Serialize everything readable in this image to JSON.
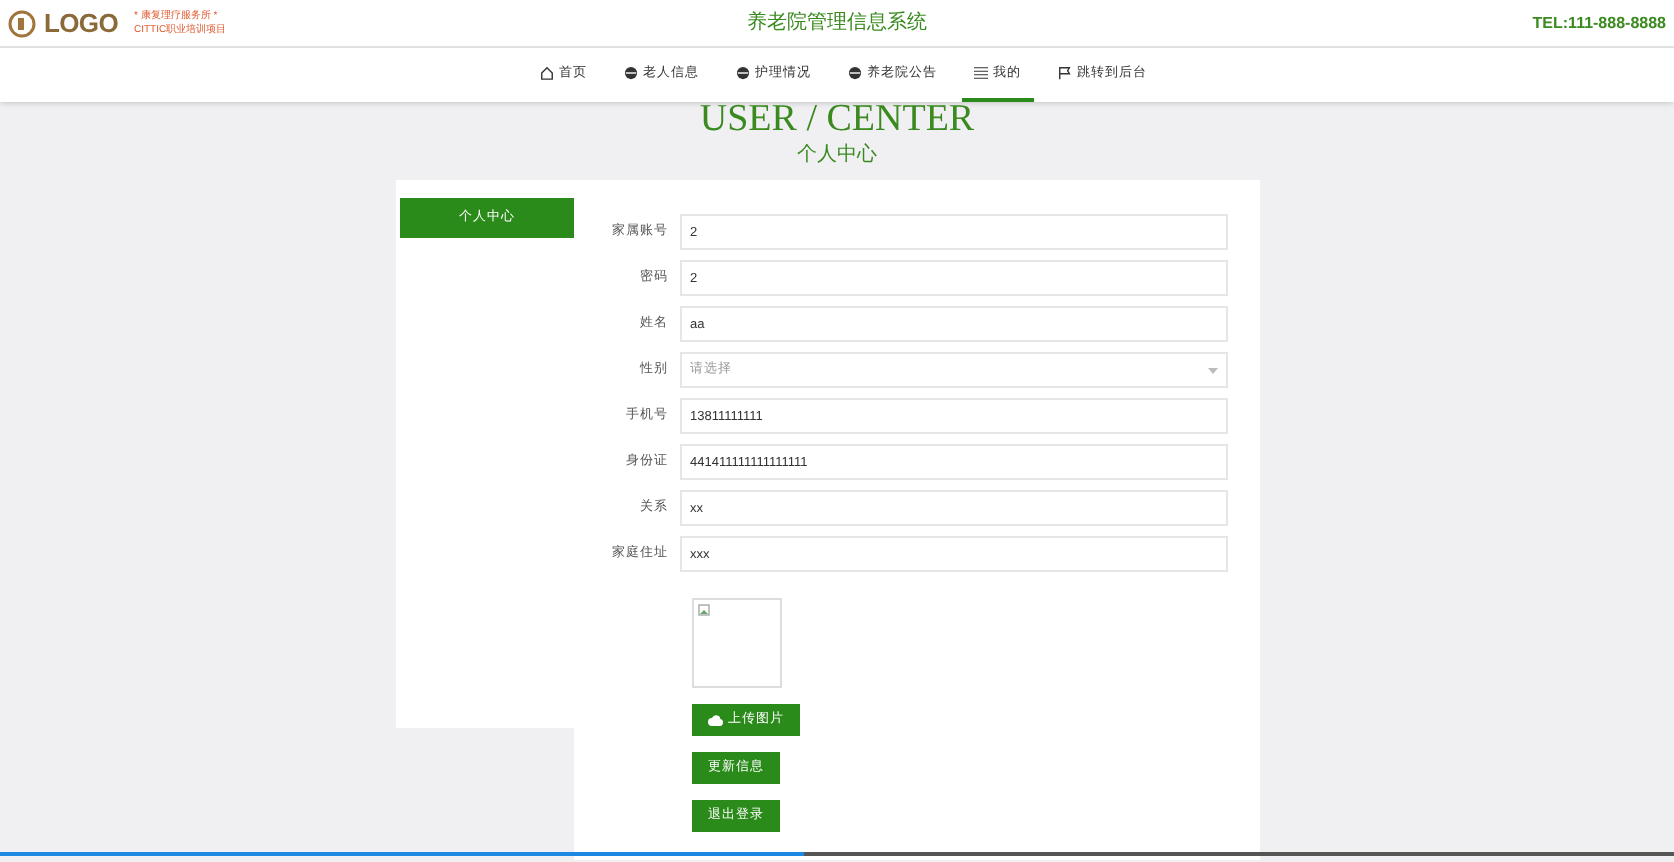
{
  "header": {
    "logo": "LOGO",
    "slogan_line_1": "* 康复理疗服务所 *",
    "slogan_line_2": "CITTIC职业培训项目",
    "title": "养老院管理信息系统",
    "phone": "TEL:111-888-8888"
  },
  "nav": [
    {
      "label": "首页",
      "kind": "home",
      "selected": false
    },
    {
      "label": "老人信息",
      "kind": "disc",
      "selected": false
    },
    {
      "label": "护理情况",
      "kind": "disc",
      "selected": false
    },
    {
      "label": "养老院公告",
      "kind": "disc",
      "selected": false
    },
    {
      "label": "我的",
      "kind": "list",
      "selected": true
    },
    {
      "label": "跳转到后台",
      "kind": "flag",
      "selected": false
    }
  ],
  "heading": {
    "title": "USER / CENTER",
    "subtitle": "个人中心"
  },
  "sidebar": [
    {
      "label": "个人中心",
      "selected": true
    }
  ],
  "form": [
    {
      "kind": "input",
      "label": "家属账号",
      "value": "2"
    },
    {
      "kind": "input",
      "label": "密码",
      "value": "2"
    },
    {
      "kind": "input",
      "label": "姓名",
      "value": "aa"
    },
    {
      "kind": "select",
      "label": "性别",
      "placeholder": "请选择"
    },
    {
      "kind": "input",
      "label": "手机号",
      "value": "13811111111"
    },
    {
      "kind": "input",
      "label": "身份证",
      "value": "441411111111111111"
    },
    {
      "kind": "input",
      "label": "关系",
      "value": "xx"
    },
    {
      "kind": "input",
      "label": "家庭住址",
      "value": "xxx"
    }
  ],
  "buttons": [
    {
      "label": "上传图片",
      "kind": "upload"
    },
    {
      "label": "更新信息",
      "kind": "plain"
    },
    {
      "label": "退出登录",
      "kind": "plain"
    }
  ],
  "video_progress": {
    "level": 0.48
  }
}
